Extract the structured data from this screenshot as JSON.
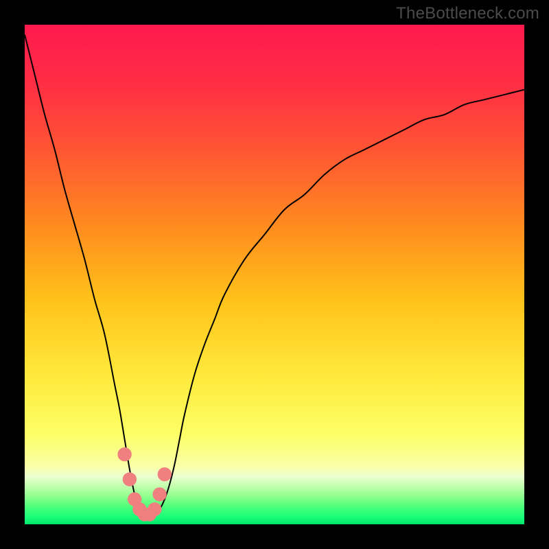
{
  "watermark": "TheBottleneck.com",
  "colors": {
    "frame": "#000000",
    "curve_stroke": "#000000",
    "marker_fill": "#f08080",
    "gradient_stops": [
      {
        "offset": 0.0,
        "color": "#ff1a4d"
      },
      {
        "offset": 0.12,
        "color": "#ff2e44"
      },
      {
        "offset": 0.25,
        "color": "#ff5533"
      },
      {
        "offset": 0.4,
        "color": "#ff8a1f"
      },
      {
        "offset": 0.55,
        "color": "#ffc21a"
      },
      {
        "offset": 0.7,
        "color": "#ffe93a"
      },
      {
        "offset": 0.82,
        "color": "#fcff66"
      },
      {
        "offset": 0.885,
        "color": "#faffa9"
      },
      {
        "offset": 0.905,
        "color": "#eaffd0"
      },
      {
        "offset": 0.922,
        "color": "#c6ffb0"
      },
      {
        "offset": 0.945,
        "color": "#8dff8d"
      },
      {
        "offset": 0.965,
        "color": "#4cff7a"
      },
      {
        "offset": 0.985,
        "color": "#1aff7a"
      },
      {
        "offset": 1.0,
        "color": "#00e56b"
      }
    ]
  },
  "chart_data": {
    "type": "line",
    "title": "",
    "xlabel": "",
    "ylabel": "",
    "xlim": [
      0,
      100
    ],
    "ylim": [
      0,
      100
    ],
    "grid": false,
    "x": [
      0,
      2,
      4,
      6,
      8,
      10,
      12,
      14,
      16,
      18,
      19,
      20,
      21,
      22,
      23,
      24,
      25,
      26,
      27,
      28,
      29,
      30,
      31,
      32,
      34,
      36,
      38,
      40,
      44,
      48,
      52,
      56,
      60,
      64,
      68,
      72,
      76,
      80,
      84,
      88,
      92,
      96,
      100
    ],
    "values": [
      98,
      90,
      82,
      75,
      67,
      60,
      53,
      45,
      38,
      28,
      23,
      17,
      11,
      6,
      3,
      2,
      2,
      2,
      3,
      5,
      8,
      12,
      17,
      22,
      30,
      36,
      41,
      46,
      53,
      58,
      63,
      66,
      70,
      73,
      75,
      77,
      79,
      81,
      82,
      84,
      85,
      86,
      87
    ],
    "markers": {
      "x": [
        20.0,
        21.0,
        22.0,
        23.0,
        24.0,
        25.0,
        26.0,
        27.0,
        28.0
      ],
      "y": [
        14.0,
        9.0,
        5.0,
        3.0,
        2.0,
        2.0,
        3.0,
        6.0,
        10.0
      ]
    },
    "annotations": []
  }
}
